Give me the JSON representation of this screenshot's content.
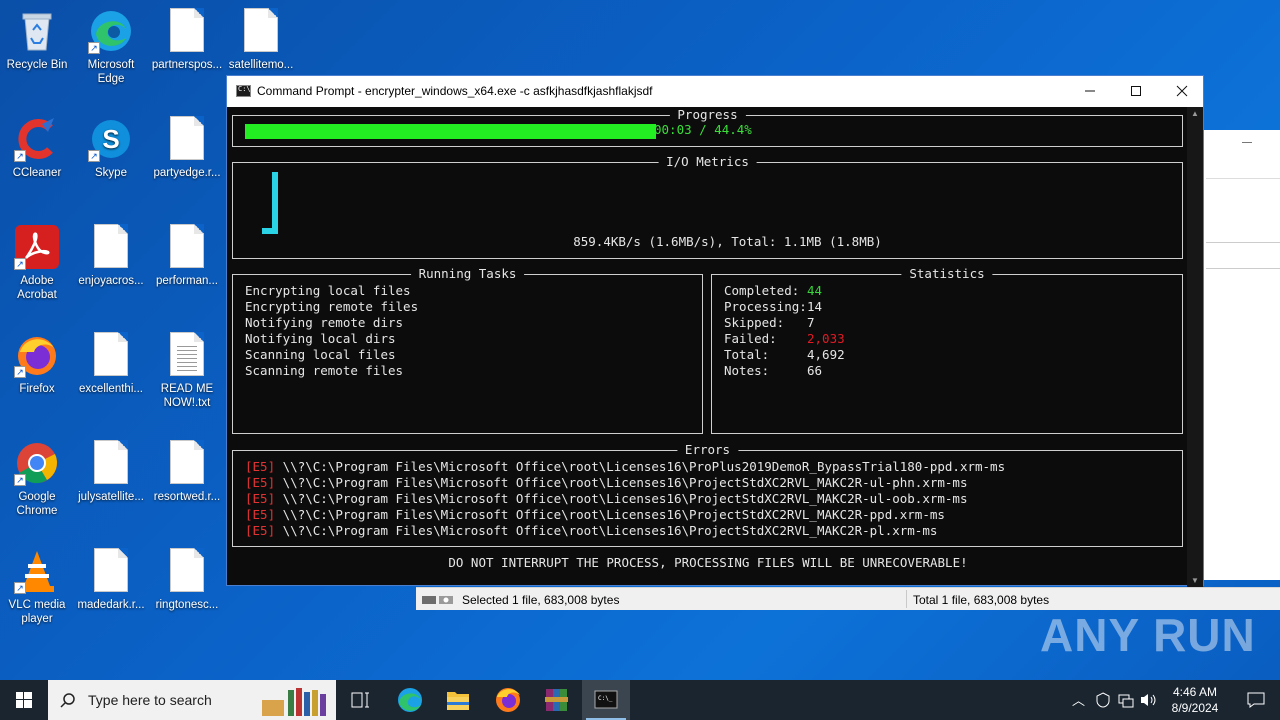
{
  "desktop": {
    "icons": [
      {
        "label": "Recycle Bin"
      },
      {
        "label": "Microsoft Edge"
      },
      {
        "label": "partnerspos..."
      },
      {
        "label": "satellitemo..."
      },
      {
        "label": "CCleaner"
      },
      {
        "label": "Skype"
      },
      {
        "label": "partyedge.r..."
      },
      {
        "label": "Adobe Acrobat"
      },
      {
        "label": "enjoyacros..."
      },
      {
        "label": "performan..."
      },
      {
        "label": "Firefox"
      },
      {
        "label": "excellenthi..."
      },
      {
        "label": "READ ME NOW!.txt"
      },
      {
        "label": "Google Chrome"
      },
      {
        "label": "julysatellite..."
      },
      {
        "label": "resortwed.r..."
      },
      {
        "label": "VLC media player"
      },
      {
        "label": "madedark.r..."
      },
      {
        "label": "ringtonesc..."
      }
    ]
  },
  "explorer": {
    "status_left": "Selected 1 file, 683,008 bytes",
    "status_right": "Total 1 file, 683,008 bytes"
  },
  "cmd": {
    "title": "Command Prompt - encrypter_windows_x64.exe  -c asfkjhasdfkjashflakjsdf",
    "progress": {
      "title": "Progress",
      "text": "00:03 / 44.4%",
      "fraction": 0.444
    },
    "io": {
      "title": "I/O Metrics",
      "text": "859.4KB/s (1.6MB/s), Total: 1.1MB (1.8MB)"
    },
    "tasks": {
      "title": "Running Tasks",
      "items": [
        "Encrypting local files",
        "Encrypting remote files",
        "Notifying remote dirs",
        "Notifying local dirs",
        "Scanning local files",
        "Scanning remote files"
      ]
    },
    "stats": {
      "title": "Statistics",
      "rows": [
        {
          "label": "Completed:",
          "value": "44"
        },
        {
          "label": "Processing:",
          "value": "14"
        },
        {
          "label": "Skipped:",
          "value": "7"
        },
        {
          "label": "Failed:",
          "value": "2,033"
        },
        {
          "label": "Total:",
          "value": "4,692"
        },
        {
          "label": "Notes:",
          "value": "66"
        }
      ]
    },
    "errors": {
      "title": "Errors",
      "tag": "[E5]",
      "items": [
        "\\\\?\\C:\\Program Files\\Microsoft Office\\root\\Licenses16\\ProPlus2019DemoR_BypassTrial180-ppd.xrm-ms",
        "\\\\?\\C:\\Program Files\\Microsoft Office\\root\\Licenses16\\ProjectStdXC2RVL_MAKC2R-ul-phn.xrm-ms",
        "\\\\?\\C:\\Program Files\\Microsoft Office\\root\\Licenses16\\ProjectStdXC2RVL_MAKC2R-ul-oob.xrm-ms",
        "\\\\?\\C:\\Program Files\\Microsoft Office\\root\\Licenses16\\ProjectStdXC2RVL_MAKC2R-ppd.xrm-ms",
        "\\\\?\\C:\\Program Files\\Microsoft Office\\root\\Licenses16\\ProjectStdXC2RVL_MAKC2R-pl.xrm-ms"
      ]
    },
    "warning": "DO NOT INTERRUPT THE PROCESS, PROCESSING FILES WILL BE UNRECOVERABLE!"
  },
  "watermark": "ANY RUN",
  "taskbar": {
    "search_placeholder": "Type here to search",
    "time": "4:46 AM",
    "date": "8/9/2024"
  },
  "colors": {
    "progress_fill": "#22ee22",
    "completed": "#37d63a",
    "failed": "#e01b24",
    "io_glyph": "#2ad4e6"
  }
}
